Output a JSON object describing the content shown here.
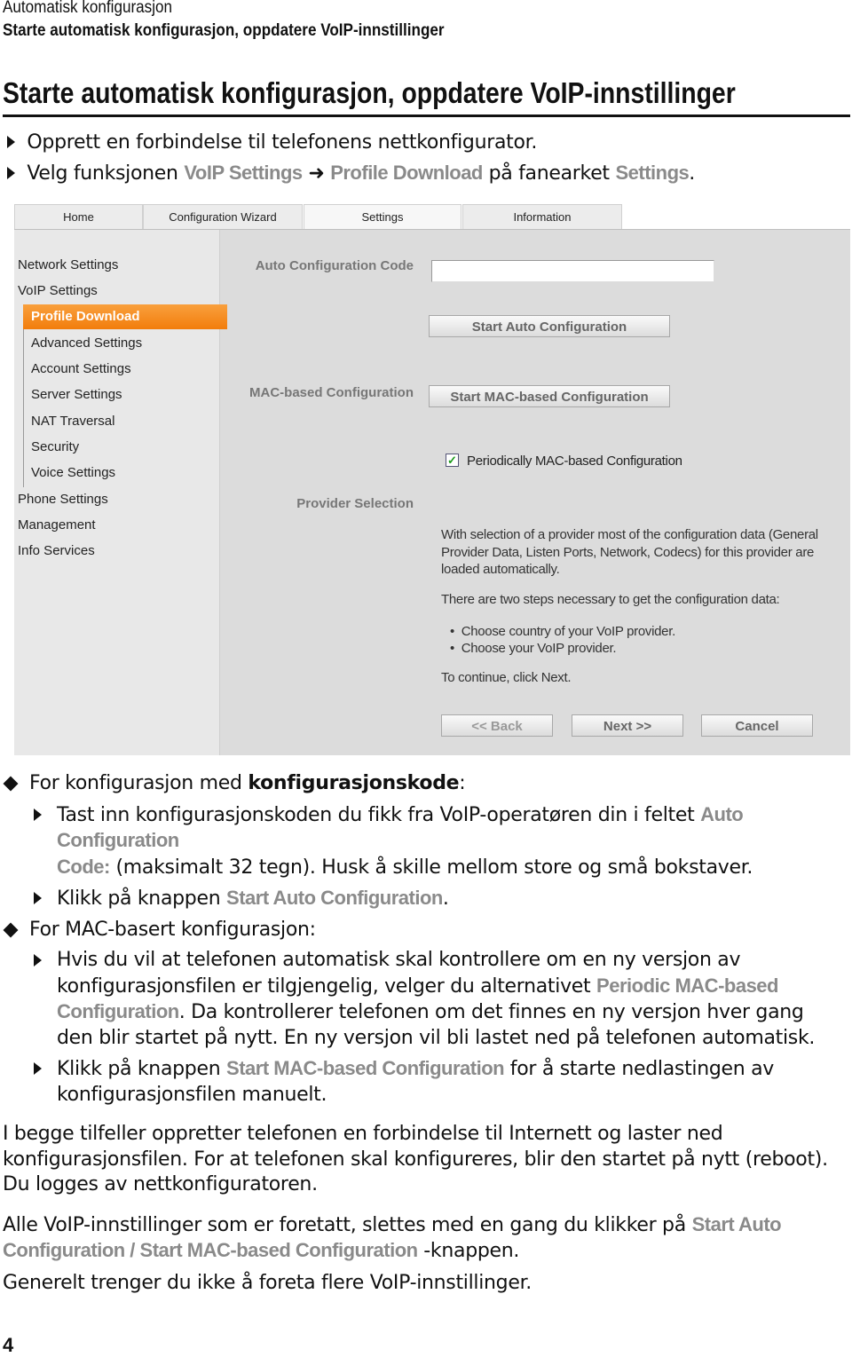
{
  "header": {
    "section": "Automatisk konfigurasjon",
    "subsection": "Starte automatisk konfigurasjon, oppdatere VoIP-innstillinger"
  },
  "title": "Starte automatisk konfigurasjon, oppdatere VoIP-innstillinger",
  "intro": {
    "step1": "Opprett en forbindelse til telefonens nettkonfigurator.",
    "step2_pre": "Velg funksjonen ",
    "step2_ui1": "VoIP Settings",
    "step2_arrow": "➜",
    "step2_ui2": "Profile Download",
    "step2_mid": " på fanearket ",
    "step2_ui3": "Settings",
    "step2_end": "."
  },
  "screenshot": {
    "tabs": [
      {
        "label": "Home"
      },
      {
        "label": "Configuration Wizard"
      },
      {
        "label": "Settings"
      },
      {
        "label": "Information"
      }
    ],
    "active_tab": "Settings",
    "nav": {
      "items": [
        "Network Settings",
        "VoIP Settings",
        "Profile Download",
        "Advanced Settings",
        "Account Settings",
        "Server Settings",
        "NAT Traversal",
        "Security",
        "Voice Settings",
        "Phone Settings",
        "Management",
        "Info Services"
      ],
      "selected": "Profile Download"
    },
    "auto_code_label": "Auto Configuration Code",
    "auto_code_value": "",
    "start_auto_button": "Start Auto Configuration",
    "mac_label": "MAC-based Configuration",
    "start_mac_button": "Start MAC-based Configuration",
    "periodic_checkbox": {
      "label": "Periodically MAC-based Configuration",
      "checked": true
    },
    "provider_label": "Provider Selection",
    "provider_p1": "With selection of a provider most of the configuration data (General Provider Data, Listen Ports, Network, Codecs) for this provider are loaded automatically.",
    "provider_p2": "There are two steps necessary to get the configuration data:",
    "provider_steps": [
      "Choose country of your VoIP provider.",
      "Choose your VoIP provider."
    ],
    "provider_p3": "To continue, click Next.",
    "back_button": "<< Back",
    "next_button": "Next >>",
    "cancel_button": "Cancel",
    "colors": {
      "selected_nav": "#f27d0c",
      "check": "#1a9a1a"
    }
  },
  "body": {
    "b1_pre": "For konfigurasjon med ",
    "b1_bold": "konfigurasjonskode",
    ":": ":",
    "b1s1_pre": "Tast inn konfigurasjonskoden du fikk fra VoIP-operatøren din i feltet ",
    "b1s1_ui": "Auto Configuration",
    "b1s1_ui2": "Code:",
    "b1s1_post": " (maksimalt 32 tegn). Husk å skille mellom store og små bokstaver.",
    "b1s2_pre": "Klikk på knappen ",
    "b1s2_ui": "Start Auto Configuration",
    "b1s2_end": ".",
    "b2": "For MAC-basert konfigurasjon:",
    "b2s1_l1": "Hvis du vil at telefonen automatisk skal kontrollere om en ny versjon av",
    "b2s1_l2_pre": "konfigurasjonsfilen er tilgjengelig, velger du alternativet ",
    "b2s1_ui": "Periodic MAC-based",
    "b2s1_ui2": "Configuration",
    "b2s1_l3_post": ". Da kontrollerer telefonen om det finnes en ny versjon hver gang",
    "b2s1_l4": "den blir startet på nytt. En ny versjon vil bli lastet ned på telefonen automatisk.",
    "b2s2_pre": "Klikk på knappen ",
    "b2s2_ui": "Start MAC-based Configuration",
    "b2s2_post": " for å starte nedlastingen av",
    "b2s2_l2": "konfigurasjonsfilen manuelt.",
    "p1_l1": "I begge tilfeller oppretter telefonen en forbindelse til Internett og laster ned",
    "p1_l2": "konfigurasjonsfilen. For at telefonen skal konfigureres, blir den startet på nytt (reboot).",
    "p1_l3": "Du logges av nettkonfiguratoren.",
    "p2_pre": "Alle VoIP-innstillinger som er foretatt, slettes med en gang du klikker på ",
    "p2_ui1": "Start Auto",
    "p2_ui2": "Configuration / Start MAC-based Configuration",
    "p2_post": " -knappen.",
    "p3": "Generelt trenger du ikke å foreta flere VoIP-innstillinger."
  },
  "page_number": "4"
}
